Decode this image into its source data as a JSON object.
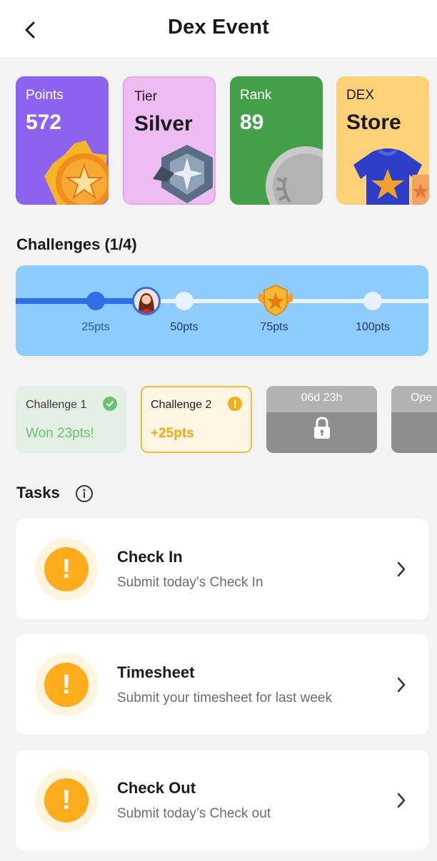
{
  "header": {
    "title": "Dex Event"
  },
  "stats": [
    {
      "label": "Points",
      "value": "572"
    },
    {
      "label": "Tier",
      "value": "Silver"
    },
    {
      "label": "Rank",
      "value": "89"
    },
    {
      "label": "DEX",
      "value": "Store"
    }
  ],
  "challenges": {
    "title": "Challenges (1/4)",
    "progress_milestones_reached": 1,
    "milestones": [
      "25pts",
      "50pts",
      "75pts",
      "100pts"
    ],
    "cards": [
      {
        "title": "Challenge 1",
        "status": "complete",
        "points": "Won 23pts!"
      },
      {
        "title": "Challenge 2",
        "status": "active",
        "points": "+25pts"
      },
      {
        "timer": "06d 23h",
        "status": "locked"
      },
      {
        "timer": "Ope",
        "status": "locked"
      }
    ]
  },
  "tasks": {
    "title": "Tasks",
    "items": [
      {
        "title": "Check In",
        "subtitle": "Submit today’s Check In"
      },
      {
        "title": "Timesheet",
        "subtitle": "Submit your timesheet for last week"
      },
      {
        "title": "Check Out",
        "subtitle": "Submit today’s Check out"
      }
    ]
  },
  "colors": {
    "points_card": "#8c63f0",
    "tier_card": "#eebcf3",
    "rank_card": "#43a048",
    "store_card": "#ffd27a",
    "progress_bg": "#8ecbff",
    "progress_fill": "#2f6fe6",
    "warning": "#fdac1b",
    "success": "#6cc36f"
  },
  "icons": [
    "back-arrow-icon",
    "medal-icon",
    "tier-badge-icon",
    "rank-medal-icon",
    "shirt-icon",
    "avatar",
    "shield-icon",
    "check-icon",
    "warning-icon",
    "lock-icon",
    "info-icon",
    "chevron-right-icon"
  ]
}
